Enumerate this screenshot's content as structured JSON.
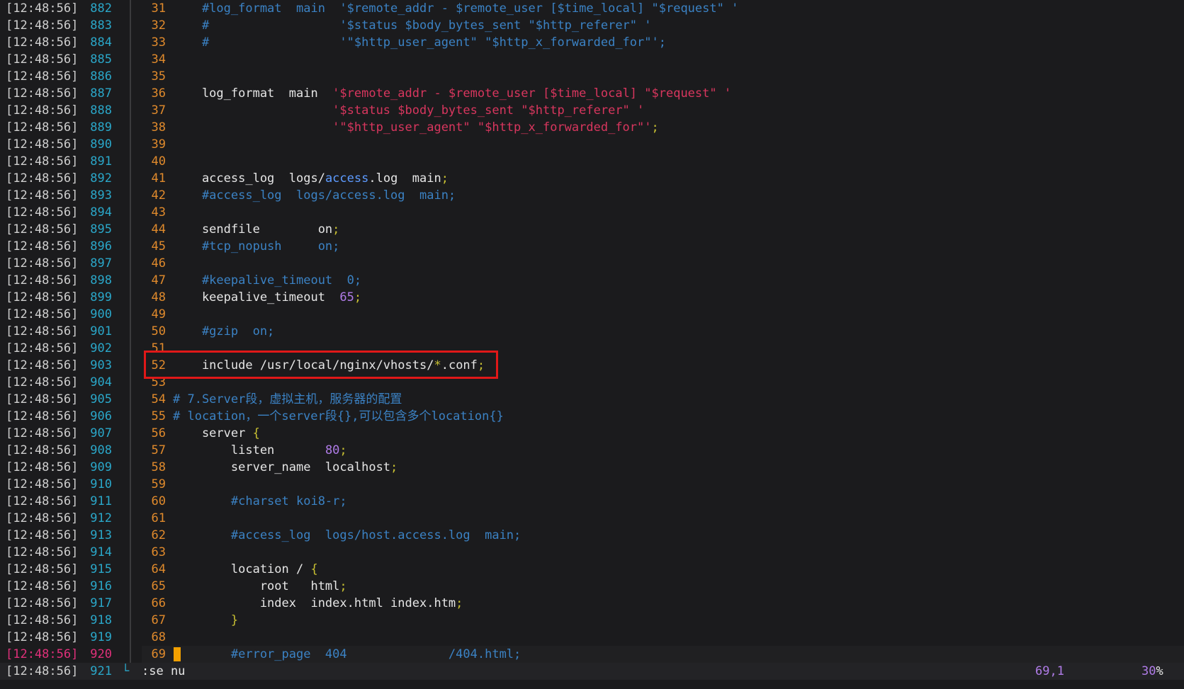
{
  "timestamp": "[12:48:56]",
  "lines": [
    {
      "term": "882",
      "vim": "31",
      "code": "    #log_format  main  '$remote_addr - $remote_user [$time_local] \"$request\" '",
      "kind": "comment"
    },
    {
      "term": "883",
      "vim": "32",
      "code": "    #                  '$status $body_bytes_sent \"$http_referer\" '",
      "kind": "comment"
    },
    {
      "term": "884",
      "vim": "33",
      "code": "    #                  '\"$http_user_agent\" \"$http_x_forwarded_for\"';",
      "kind": "comment"
    },
    {
      "term": "885",
      "vim": "34",
      "code": "",
      "kind": "plain"
    },
    {
      "term": "886",
      "vim": "35",
      "code": "",
      "kind": "plain"
    },
    {
      "term": "887",
      "vim": "36",
      "code": "    log_format  main  '$remote_addr - $remote_user [$time_local] \"$request\" '",
      "kind": "logfmt"
    },
    {
      "term": "888",
      "vim": "37",
      "code": "                      '$status $body_bytes_sent \"$http_referer\" '",
      "kind": "string"
    },
    {
      "term": "889",
      "vim": "38",
      "code": "                      '\"$http_user_agent\" \"$http_x_forwarded_for\"';",
      "kind": "string-end"
    },
    {
      "term": "890",
      "vim": "39",
      "code": "",
      "kind": "plain"
    },
    {
      "term": "891",
      "vim": "40",
      "code": "",
      "kind": "plain"
    },
    {
      "term": "892",
      "vim": "41",
      "code": "    access_log  logs/access.log  main;",
      "kind": "accesslog"
    },
    {
      "term": "893",
      "vim": "42",
      "code": "    #access_log  logs/access.log  main;",
      "kind": "comment"
    },
    {
      "term": "894",
      "vim": "43",
      "code": "",
      "kind": "plain"
    },
    {
      "term": "895",
      "vim": "44",
      "code": "    sendfile        on;",
      "kind": "directive"
    },
    {
      "term": "896",
      "vim": "45",
      "code": "    #tcp_nopush     on;",
      "kind": "comment"
    },
    {
      "term": "897",
      "vim": "46",
      "code": "",
      "kind": "plain"
    },
    {
      "term": "898",
      "vim": "47",
      "code": "    #keepalive_timeout  0;",
      "kind": "comment"
    },
    {
      "term": "899",
      "vim": "48",
      "code": "    keepalive_timeout  65;",
      "kind": "number"
    },
    {
      "term": "900",
      "vim": "49",
      "code": "",
      "kind": "plain"
    },
    {
      "term": "901",
      "vim": "50",
      "code": "    #gzip  on;",
      "kind": "comment"
    },
    {
      "term": "902",
      "vim": "51",
      "code": "",
      "kind": "plain"
    },
    {
      "term": "903",
      "vim": "52",
      "code": "    include /usr/local/nginx/vhosts/*.conf;",
      "kind": "include"
    },
    {
      "term": "904",
      "vim": "53",
      "code": "",
      "kind": "plain"
    },
    {
      "term": "905",
      "vim": "54",
      "code": "# 7.Server段，虚拟主机，服务器的配置",
      "kind": "comment"
    },
    {
      "term": "906",
      "vim": "55",
      "code": "# location，一个server段{},可以包含多个location{}",
      "kind": "comment"
    },
    {
      "term": "907",
      "vim": "56",
      "code": "    server {",
      "kind": "brace"
    },
    {
      "term": "908",
      "vim": "57",
      "code": "        listen       80;",
      "kind": "number"
    },
    {
      "term": "909",
      "vim": "58",
      "code": "        server_name  localhost;",
      "kind": "directive"
    },
    {
      "term": "910",
      "vim": "59",
      "code": "",
      "kind": "plain"
    },
    {
      "term": "911",
      "vim": "60",
      "code": "        #charset koi8-r;",
      "kind": "comment"
    },
    {
      "term": "912",
      "vim": "61",
      "code": "",
      "kind": "plain"
    },
    {
      "term": "913",
      "vim": "62",
      "code": "        #access_log  logs/host.access.log  main;",
      "kind": "comment"
    },
    {
      "term": "914",
      "vim": "63",
      "code": "",
      "kind": "plain"
    },
    {
      "term": "915",
      "vim": "64",
      "code": "        location / {",
      "kind": "brace"
    },
    {
      "term": "916",
      "vim": "65",
      "code": "            root   html;",
      "kind": "directive"
    },
    {
      "term": "917",
      "vim": "66",
      "code": "            index  index.html index.htm;",
      "kind": "directive"
    },
    {
      "term": "918",
      "vim": "67",
      "code": "        }",
      "kind": "brace"
    },
    {
      "term": "919",
      "vim": "68",
      "code": "",
      "kind": "plain"
    },
    {
      "term": "920",
      "vim": "69",
      "code": "        #error_page  404              /404.html;",
      "kind": "comment",
      "current": true
    }
  ],
  "status": {
    "term": "921",
    "command": ":se nu",
    "position": "69,1",
    "percent_num": "30",
    "percent_sign": "%"
  },
  "colors": {
    "background": "#1b1b1d",
    "comment": "#3b82c4",
    "string": "#d8365e",
    "line_number": "#e08a2c",
    "terminal_line": "#2aa7c9",
    "highlight_box": "#e01818",
    "cursor": "#f2a000"
  }
}
